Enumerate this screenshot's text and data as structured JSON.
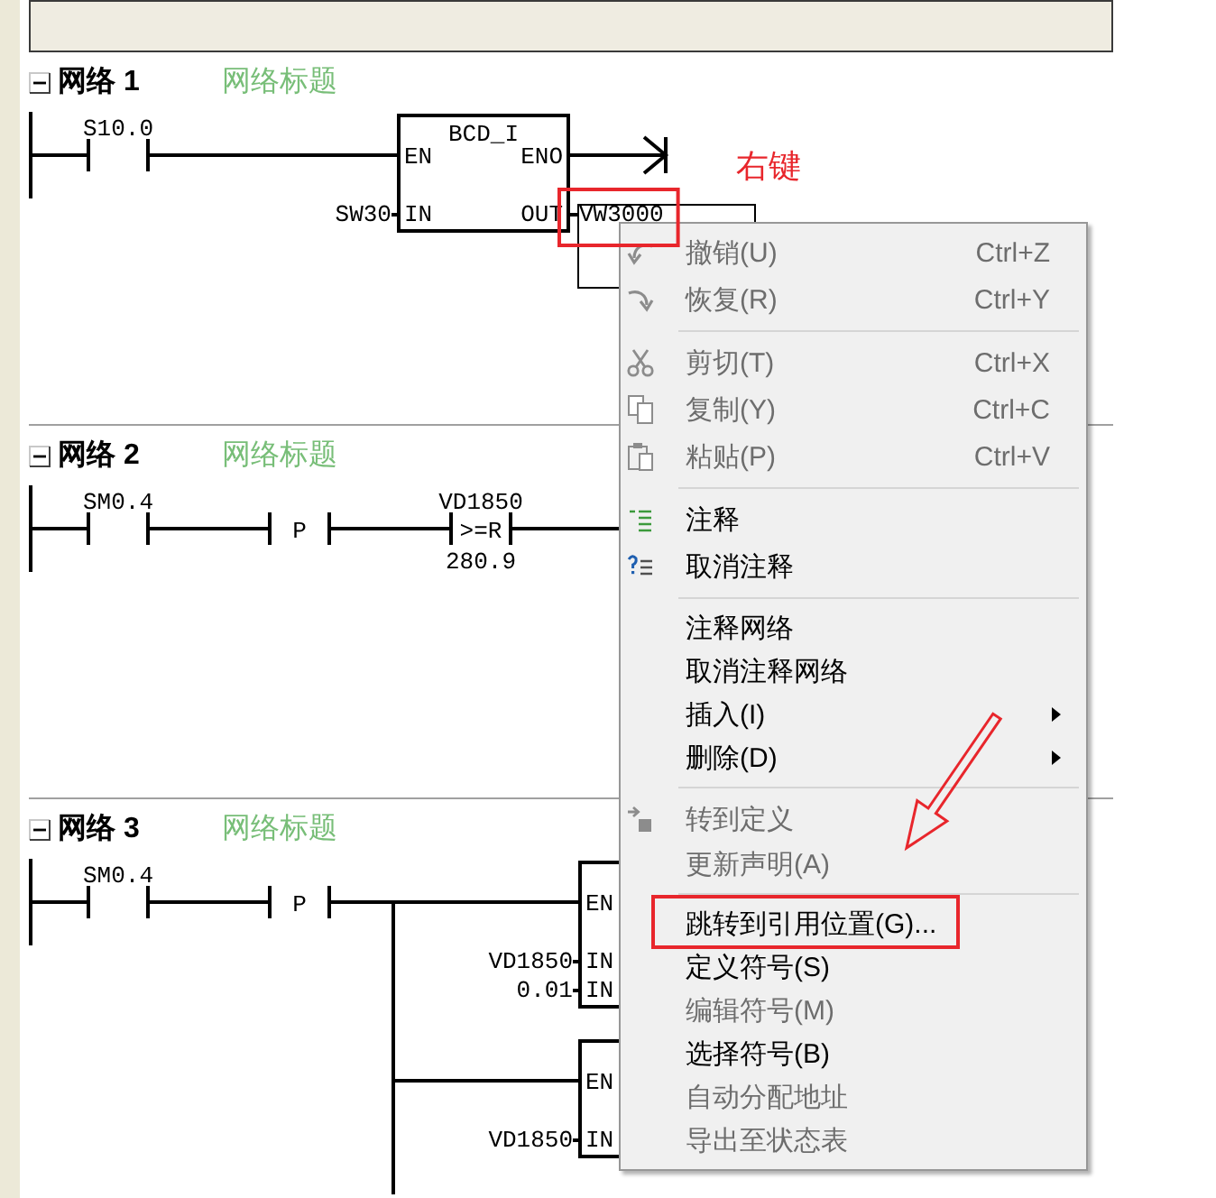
{
  "networks": [
    {
      "label": "网络 1",
      "title": "网络标题",
      "expanded": true,
      "rung": [
        {
          "kind": "contact",
          "operand": "S10.0"
        },
        {
          "kind": "box",
          "title": "BCD_I",
          "inputs": [
            {
              "pin": "EN"
            },
            {
              "pin": "IN",
              "operand": "SW30"
            }
          ],
          "outputs": [
            {
              "pin": "ENO",
              "marked": false
            },
            {
              "pin": "OUT",
              "operand": "VW3000",
              "marked": true
            }
          ]
        },
        {
          "kind": "open_end"
        }
      ]
    },
    {
      "label": "网络 2",
      "title": "网络标题",
      "expanded": true,
      "rung": [
        {
          "kind": "contact",
          "operand": "SM0.4"
        },
        {
          "kind": "transition",
          "symbol": "P"
        },
        {
          "kind": "compare",
          "operand": "VD1850",
          "symbol": ">=R",
          "operand_2": "280.9"
        },
        {
          "kind": "wire"
        }
      ]
    },
    {
      "label": "网络 3",
      "title": "网络标题",
      "expanded": true,
      "rung": [
        {
          "kind": "contact",
          "operand": "SM0.4"
        },
        {
          "kind": "transition",
          "symbol": "P"
        },
        {
          "kind": "parallel",
          "more_below": true,
          "branches": [
            {
              "kind": "box",
              "inputs": [
                {
                  "pin": "EN"
                },
                {
                  "pin": "IN",
                  "operand": "VD1850"
                },
                {
                  "pin": "IN",
                  "operand": "0.01"
                }
              ]
            },
            {
              "kind": "box",
              "inputs": [
                {
                  "pin": "EN"
                },
                {
                  "pin": "IN",
                  "operand": "VD1850"
                }
              ]
            }
          ]
        }
      ]
    }
  ],
  "context_menu": {
    "sections": [
      {
        "items": [
          {
            "label": "撤销(U)",
            "shortcut": "Ctrl+Z",
            "disabled": true,
            "submenu": false,
            "marked": false
          },
          {
            "label": "恢复(R)",
            "shortcut": "Ctrl+Y",
            "disabled": true,
            "submenu": false,
            "marked": false
          }
        ]
      },
      {
        "items": [
          {
            "label": "剪切(T)",
            "shortcut": "Ctrl+X",
            "disabled": true,
            "submenu": false,
            "marked": false
          },
          {
            "label": "复制(Y)",
            "shortcut": "Ctrl+C",
            "disabled": true,
            "submenu": false,
            "marked": false
          },
          {
            "label": "粘贴(P)",
            "shortcut": "Ctrl+V",
            "disabled": true,
            "submenu": false,
            "marked": false
          }
        ]
      },
      {
        "items": [
          {
            "label": "注释",
            "disabled": false,
            "submenu": false,
            "marked": false
          },
          {
            "label": "取消注释",
            "disabled": false,
            "submenu": false,
            "marked": false
          }
        ]
      },
      {
        "items": [
          {
            "label": "注释网络",
            "disabled": false,
            "submenu": false,
            "marked": false
          },
          {
            "label": "取消注释网络",
            "disabled": false,
            "submenu": false,
            "marked": false
          },
          {
            "label": "插入(I)",
            "disabled": false,
            "submenu": true,
            "marked": false
          },
          {
            "label": "删除(D)",
            "disabled": false,
            "submenu": true,
            "marked": false
          }
        ]
      },
      {
        "items": [
          {
            "label": "转到定义",
            "disabled": true,
            "submenu": false,
            "marked": false
          },
          {
            "label": "更新声明(A)",
            "disabled": true,
            "submenu": false,
            "marked": false
          }
        ]
      },
      {
        "items": [
          {
            "label": "跳转到引用位置(G)...",
            "disabled": false,
            "submenu": false,
            "marked": true
          },
          {
            "label": "定义符号(S)",
            "disabled": false,
            "submenu": false,
            "marked": false
          },
          {
            "label": "编辑符号(M)",
            "disabled": true,
            "submenu": false,
            "marked": false
          },
          {
            "label": "选择符号(B)",
            "disabled": false,
            "submenu": false,
            "marked": false
          },
          {
            "label": "自动分配地址",
            "disabled": true,
            "submenu": false,
            "marked": false
          },
          {
            "label": "导出至状态表",
            "disabled": true,
            "submenu": false,
            "marked": false
          }
        ]
      }
    ]
  },
  "annotations": [
    {
      "kind": "text",
      "text": "右键"
    },
    {
      "kind": "arrow"
    }
  ]
}
